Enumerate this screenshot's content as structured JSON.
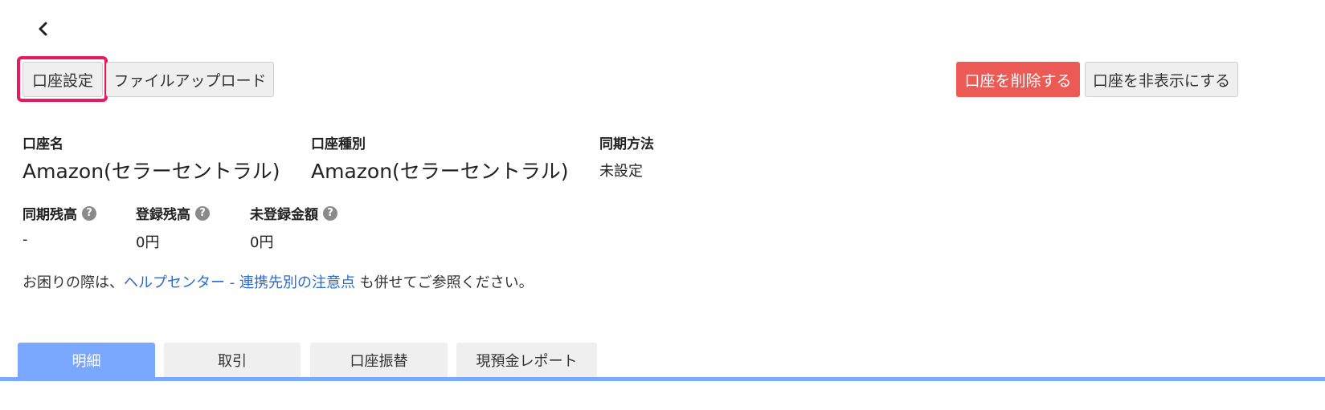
{
  "header": {
    "back_icon": "chevron-left-icon"
  },
  "toolbar": {
    "account_settings_label": "口座設定",
    "file_upload_label": "ファイルアップロード",
    "delete_account_label": "口座を削除する",
    "hide_account_label": "口座を非表示にする",
    "colors": {
      "danger": "#ec5a56",
      "highlight": "#e8195f"
    }
  },
  "account_info": {
    "name_label": "口座名",
    "name_value": "Amazon(セラーセントラル)",
    "type_label": "口座種別",
    "type_value": "Amazon(セラーセントラル)",
    "sync_method_label": "同期方法",
    "sync_method_value": "未設定"
  },
  "balances": {
    "synced_label": "同期残高",
    "synced_value": "-",
    "registered_label": "登録残高",
    "registered_value": "0円",
    "unregistered_label": "未登録金額",
    "unregistered_value": "0円",
    "help_icon": "question-circle-icon"
  },
  "help_note": {
    "prefix": "お困りの際は、",
    "link1": "ヘルプセンター",
    "separator": " - ",
    "link2": "連携先別の注意点",
    "suffix": " も併せてご参照ください。",
    "link_color": "#2a6ccb"
  },
  "tabs": [
    {
      "label": "明細",
      "active": true
    },
    {
      "label": "取引",
      "active": false
    },
    {
      "label": "口座振替",
      "active": false
    },
    {
      "label": "現預金レポート",
      "active": false
    }
  ],
  "tab_accent_color": "#7aa7ff"
}
